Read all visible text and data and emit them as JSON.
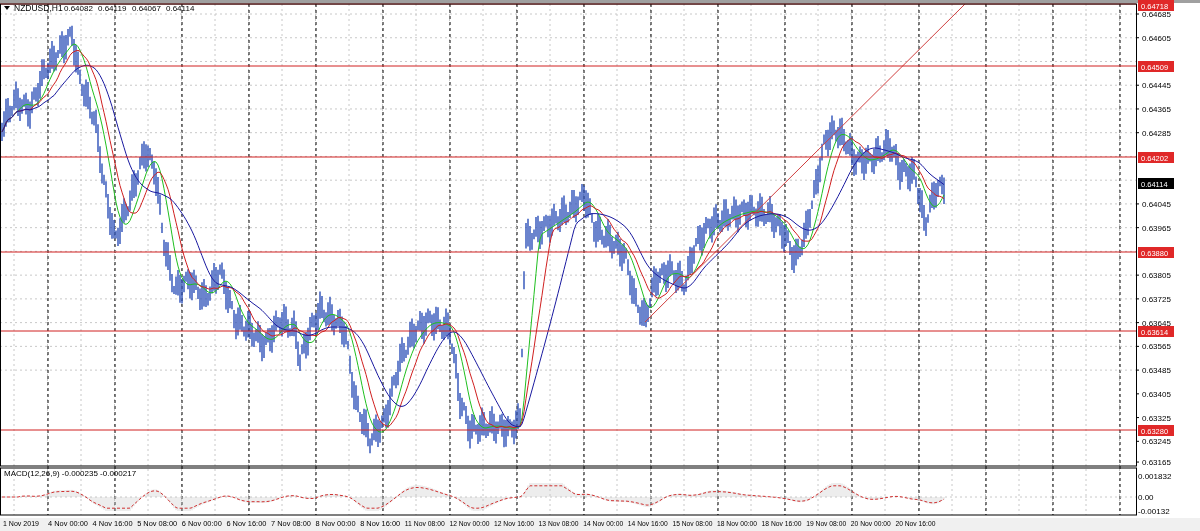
{
  "chart_header": {
    "symbol": "NZDUSD,H1",
    "quotes": [
      "0.64082",
      "0.64119",
      "0.64067",
      "0.64114"
    ]
  },
  "price_axis": [
    "0.64685",
    "0.64605",
    "0.64445",
    "0.64365",
    "0.64285",
    "0.64045",
    "0.63965",
    "0.63805",
    "0.63725",
    "0.63645",
    "0.63565",
    "0.63485",
    "0.63405",
    "0.63325",
    "0.63245",
    "0.63165"
  ],
  "level_lines": [
    "0.64718",
    "0.64509",
    "0.64202",
    "0.63880",
    "0.63614",
    "0.63280"
  ],
  "current_price": "0.64114",
  "macd": {
    "label": "MACD(12,26,9) -0.000235 -0.000217",
    "axis": [
      "0.001832",
      "0.00",
      "-0.00132"
    ]
  },
  "time_axis": [
    "1 Nov 2019",
    "4 Nov 00:00",
    "4 Nov 16:00",
    "5 Nov 08:00",
    "6 Nov 00:00",
    "6 Nov 16:00",
    "7 Nov 08:00",
    "8 Nov 00:00",
    "8 Nov 16:00",
    "11 Nov 08:00",
    "12 Nov 00:00",
    "12 Nov 16:00",
    "13 Nov 08:00",
    "14 Nov 00:00",
    "14 Nov 16:00",
    "15 Nov 08:00",
    "18 Nov 00:00",
    "18 Nov 16:00",
    "19 Nov 08:00",
    "20 Nov 00:00",
    "20 Nov 16:00"
  ]
}
